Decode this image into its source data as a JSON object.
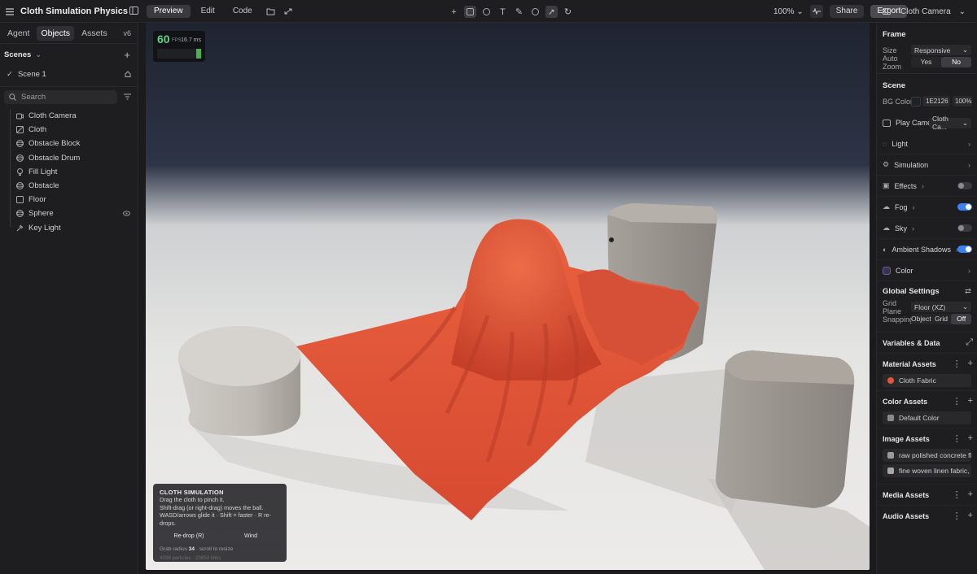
{
  "app": {
    "title": "Cloth Simulation Physics"
  },
  "modes": [
    {
      "label": "Preview",
      "active": true
    },
    {
      "label": "Edit"
    },
    {
      "label": "Code"
    }
  ],
  "toolbar": {
    "zoom": "100%",
    "share": "Share",
    "export": "Export",
    "camera": "Cloth Camera"
  },
  "left": {
    "tabs": [
      {
        "label": "Agent"
      },
      {
        "label": "Objects",
        "active": true
      },
      {
        "label": "Assets"
      }
    ],
    "version": "v6",
    "scenes_label": "Scenes",
    "scene": "Scene 1",
    "search_placeholder": "Search",
    "objects": [
      {
        "label": "Cloth Camera",
        "icon": "camera-icon"
      },
      {
        "label": "Cloth",
        "icon": "cloth-icon"
      },
      {
        "label": "Obstacle Block",
        "icon": "sphere-icon"
      },
      {
        "label": "Obstacle Drum",
        "icon": "sphere-icon"
      },
      {
        "label": "Fill Light",
        "icon": "bulb-icon"
      },
      {
        "label": "Obstacle",
        "icon": "sphere-icon"
      },
      {
        "label": "Floor",
        "icon": "plane-icon"
      },
      {
        "label": "Sphere",
        "icon": "sphere-icon"
      },
      {
        "label": "Key Light",
        "icon": "light-icon"
      }
    ]
  },
  "viewport": {
    "fps": "60",
    "fps_unit": "FPS",
    "ms": "16.7 ms",
    "info": {
      "title": "CLOTH SIMULATION",
      "line1": "Drag the cloth to pinch it.",
      "line2": "Shift-drag (or right-drag) moves the ball.",
      "line3": "WASD/arrows glide it · Shift = faster · R re-drops.",
      "btn_redrop": "Re-drop (R)",
      "btn_wind": "Wind",
      "grab_prefix": "Grab radius",
      "grab_value": "34",
      "grab_suffix": "· scroll to resize",
      "particles": "4096 particles · 23850 links"
    }
  },
  "right": {
    "frame": {
      "title": "Frame",
      "size_label": "Size",
      "size_value": "Responsive",
      "autozoom_label": "Auto Zoom",
      "yes": "Yes",
      "no": "No"
    },
    "scene": {
      "title": "Scene",
      "bg_label": "BG Color",
      "bg_hex": "1E2126",
      "bg_opacity": "100%",
      "bg_color": "#1E2126",
      "play_label": "Play Camera",
      "play_value": "Cloth Ca..."
    },
    "items": [
      {
        "label": "Light"
      },
      {
        "label": "Simulation"
      },
      {
        "label": "Effects",
        "toggle": false
      },
      {
        "label": "Fog",
        "toggle": true
      },
      {
        "label": "Sky",
        "toggle": false
      },
      {
        "label": "Ambient Shadows",
        "toggle": true
      },
      {
        "label": "Color"
      }
    ],
    "global": {
      "title": "Global Settings",
      "grid_label": "Grid Plane",
      "grid_value": "Floor (XZ)",
      "snap_label": "Snapping",
      "object": "Object",
      "grid": "Grid",
      "off": "Off"
    },
    "variables": "Variables & Data",
    "material_assets": {
      "title": "Material Assets",
      "items": [
        "Cloth Fabric"
      ]
    },
    "color_assets": {
      "title": "Color Assets",
      "items": [
        "Default Color"
      ]
    },
    "image_assets": {
      "title": "Image Assets",
      "items": [
        "raw polished concrete fl...",
        "fine woven linen fabric, ..."
      ]
    },
    "media_assets": "Media Assets",
    "audio_assets": "Audio Assets"
  },
  "colors": {
    "cloth": "#e2553a",
    "accent": "#3b82f6",
    "fps_green": "#5fd18a"
  }
}
